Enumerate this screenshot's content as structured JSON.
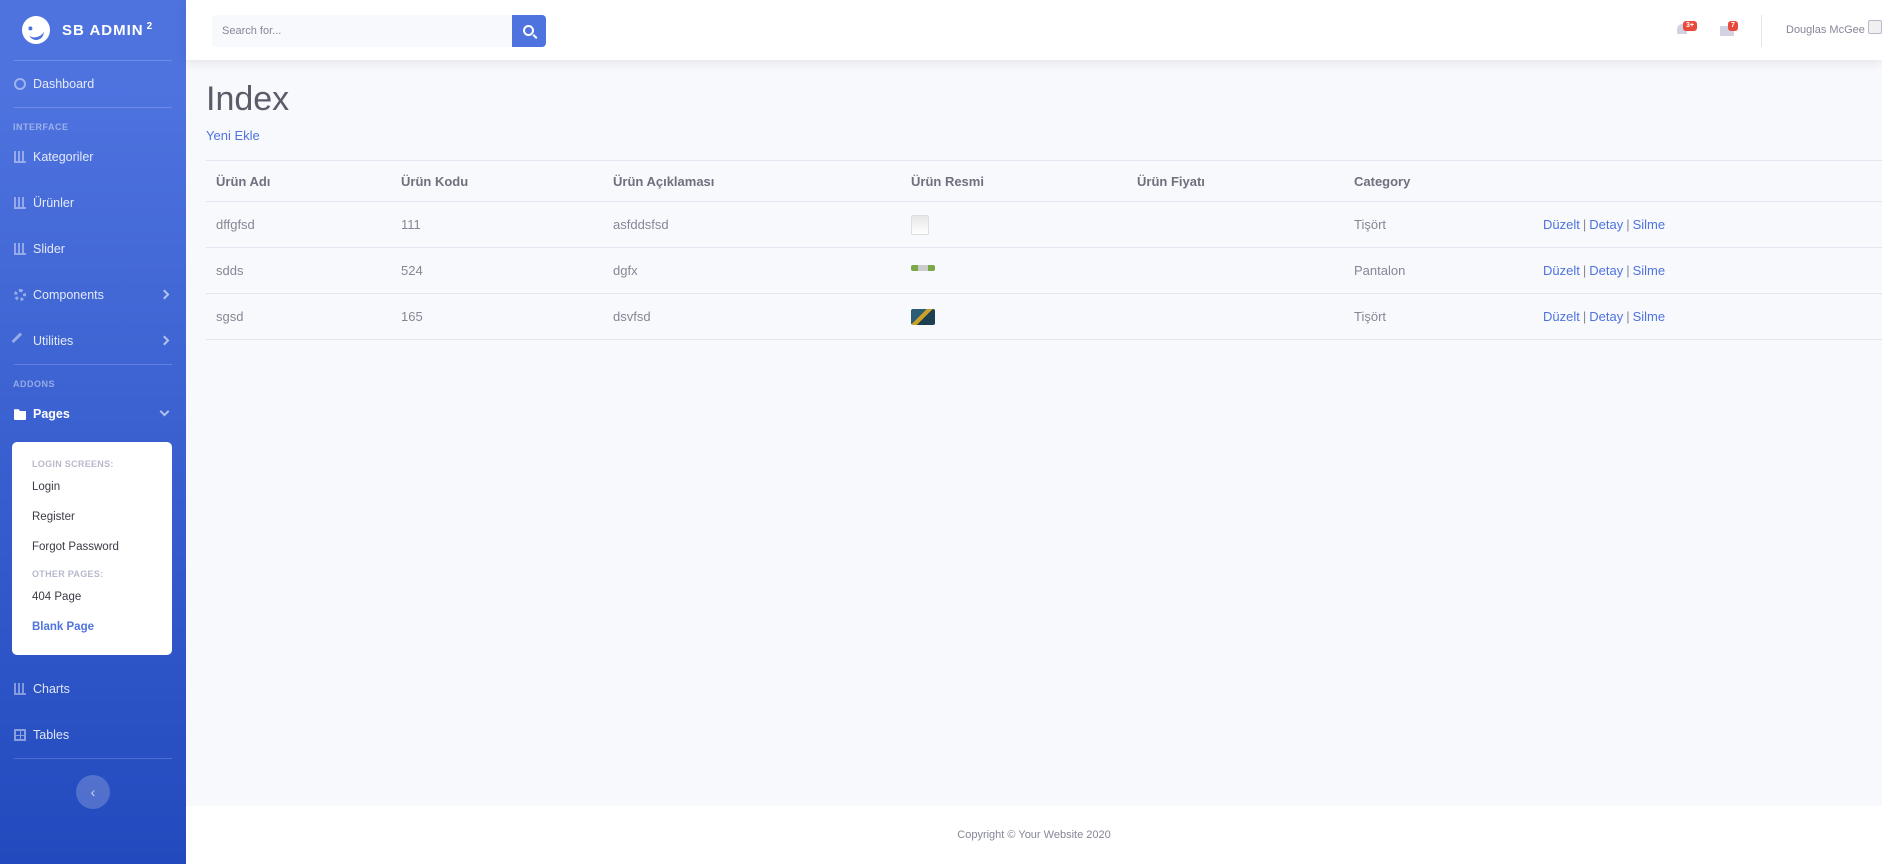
{
  "brand": {
    "name": "SB ADMIN",
    "sup": "2"
  },
  "sidebar": {
    "dashboard": "Dashboard",
    "heading_interface": "INTERFACE",
    "items": [
      {
        "label": "Kategoriler",
        "icon": "chart-icon"
      },
      {
        "label": "Ürünler",
        "icon": "chart-icon"
      },
      {
        "label": "Slider",
        "icon": "chart-icon"
      },
      {
        "label": "Components",
        "icon": "gear-icon"
      },
      {
        "label": "Utilities",
        "icon": "wrench-icon"
      }
    ],
    "heading_addons": "ADDONS",
    "pages": "Pages",
    "collapse": {
      "login_heading": "LOGIN SCREENS:",
      "login": "Login",
      "register": "Register",
      "forgot": "Forgot Password",
      "other_heading": "OTHER PAGES:",
      "notfound": "404 Page",
      "blank": "Blank Page"
    },
    "charts": "Charts",
    "tables": "Tables",
    "toggle": "‹"
  },
  "topbar": {
    "search_placeholder": "Search for...",
    "alerts_badge": "3+",
    "messages_badge": "7",
    "user_name": "Douglas McGee"
  },
  "main": {
    "title": "Index",
    "new_link": "Yeni Ekle",
    "columns": [
      "Ürün Adı",
      "Ürün Kodu",
      "Ürün Açıklaması",
      "Ürün Resmi",
      "Ürün Fiyatı",
      "Category"
    ],
    "rows": [
      {
        "name": "dffgfsd",
        "code": "111",
        "desc": "asfddsfsd",
        "price": "",
        "category": "Tişört"
      },
      {
        "name": "sdds",
        "code": "524",
        "desc": "dgfx",
        "price": "",
        "category": "Pantalon"
      },
      {
        "name": "sgsd",
        "code": "165",
        "desc": "dsvfsd",
        "price": "",
        "category": "Tişört"
      }
    ],
    "actions": {
      "edit": "Düzelt",
      "detail": "Detay",
      "delete": "Silme",
      "sep": "|"
    }
  },
  "footer": {
    "copyright": "Copyright © Your Website 2020"
  },
  "colors": {
    "primary": "#4e73df",
    "danger": "#e74a3b",
    "text": "#858796"
  }
}
